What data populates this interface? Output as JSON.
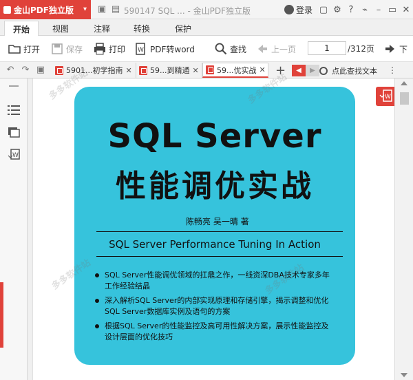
{
  "app": {
    "name": "金山PDF独立版",
    "document_title": "590147 SQL ... - 金山PDF独立版",
    "login_label": "登录",
    "help_label": "?",
    "caret": "▾"
  },
  "menu_tabs": [
    "开始",
    "视图",
    "注释",
    "转换",
    "保护"
  ],
  "toolbar": {
    "open": "打开",
    "save": "保存",
    "print": "打印",
    "pdf_to_word": "PDF转word",
    "find": "查找",
    "prev_page": "上一页",
    "page_value": "1",
    "page_total": "/312页",
    "next_page": "下"
  },
  "doc_tabs": [
    {
      "label": "5901...初学指南",
      "close": "✕"
    },
    {
      "label": "59...到精通",
      "close": "✕"
    },
    {
      "label": "59...优实战",
      "close": "✕"
    }
  ],
  "doc_tab_bar": {
    "plus": "+",
    "search_hint": "点此查找文本",
    "more": "⋮"
  },
  "cover": {
    "title": "SQL Server",
    "subtitle": "性能调优实战",
    "authors": "陈畅亮  吴一晴  著",
    "english_title": "SQL Server Performance Tuning In Action",
    "bullets": [
      "SQL Server性能调优领域的扛鼎之作，一线资深DBA技术专家多年工作经验结晶",
      "深入解析SQL Server的内部实现原理和存储引擎，揭示调整和优化SQL Server数据库实例及语句的方案",
      "根据SQL Server的性能监控及高可用性解决方案，展示性能监控及设计层面的优化技巧"
    ]
  },
  "watermark": "多多软件站",
  "colors": {
    "accent": "#e0423a",
    "cover": "#36c3dc"
  },
  "icons": [
    "undo-icon",
    "redo-icon",
    "save-icon",
    "open-icon",
    "print-icon",
    "find-icon",
    "login-icon",
    "settings-icon",
    "minimize-icon",
    "maximize-icon",
    "close-icon",
    "list-icon",
    "thumbnail-icon",
    "convert-icon"
  ]
}
